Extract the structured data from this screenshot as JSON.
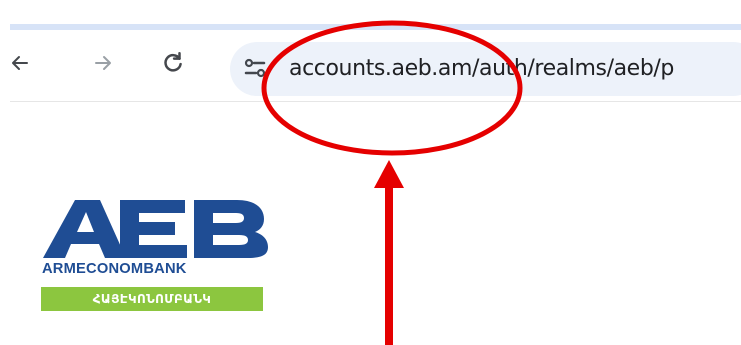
{
  "browser": {
    "back_icon": "back-arrow-icon",
    "forward_icon": "forward-arrow-icon",
    "reload_icon": "reload-icon",
    "site_info_icon": "site-info-icon",
    "address_bar": {
      "value": "accounts.aeb.am/auth/realms/aeb/p"
    }
  },
  "logo": {
    "mark_text": "AEB",
    "name": "ARMECONOMBANK",
    "armenian_name": "ՀԱՅԷԿՈՆՈՄԲԱՆԿ"
  },
  "annotation": {
    "highlight_icon": "red-ellipse-icon",
    "pointer_icon": "red-arrow-icon",
    "color": "#e50000"
  },
  "colors": {
    "brand_blue": "#1f4d94",
    "brand_green": "#8cc63f",
    "omnibox_bg": "#edf2fa",
    "top_strip": "#d7e3f7"
  }
}
